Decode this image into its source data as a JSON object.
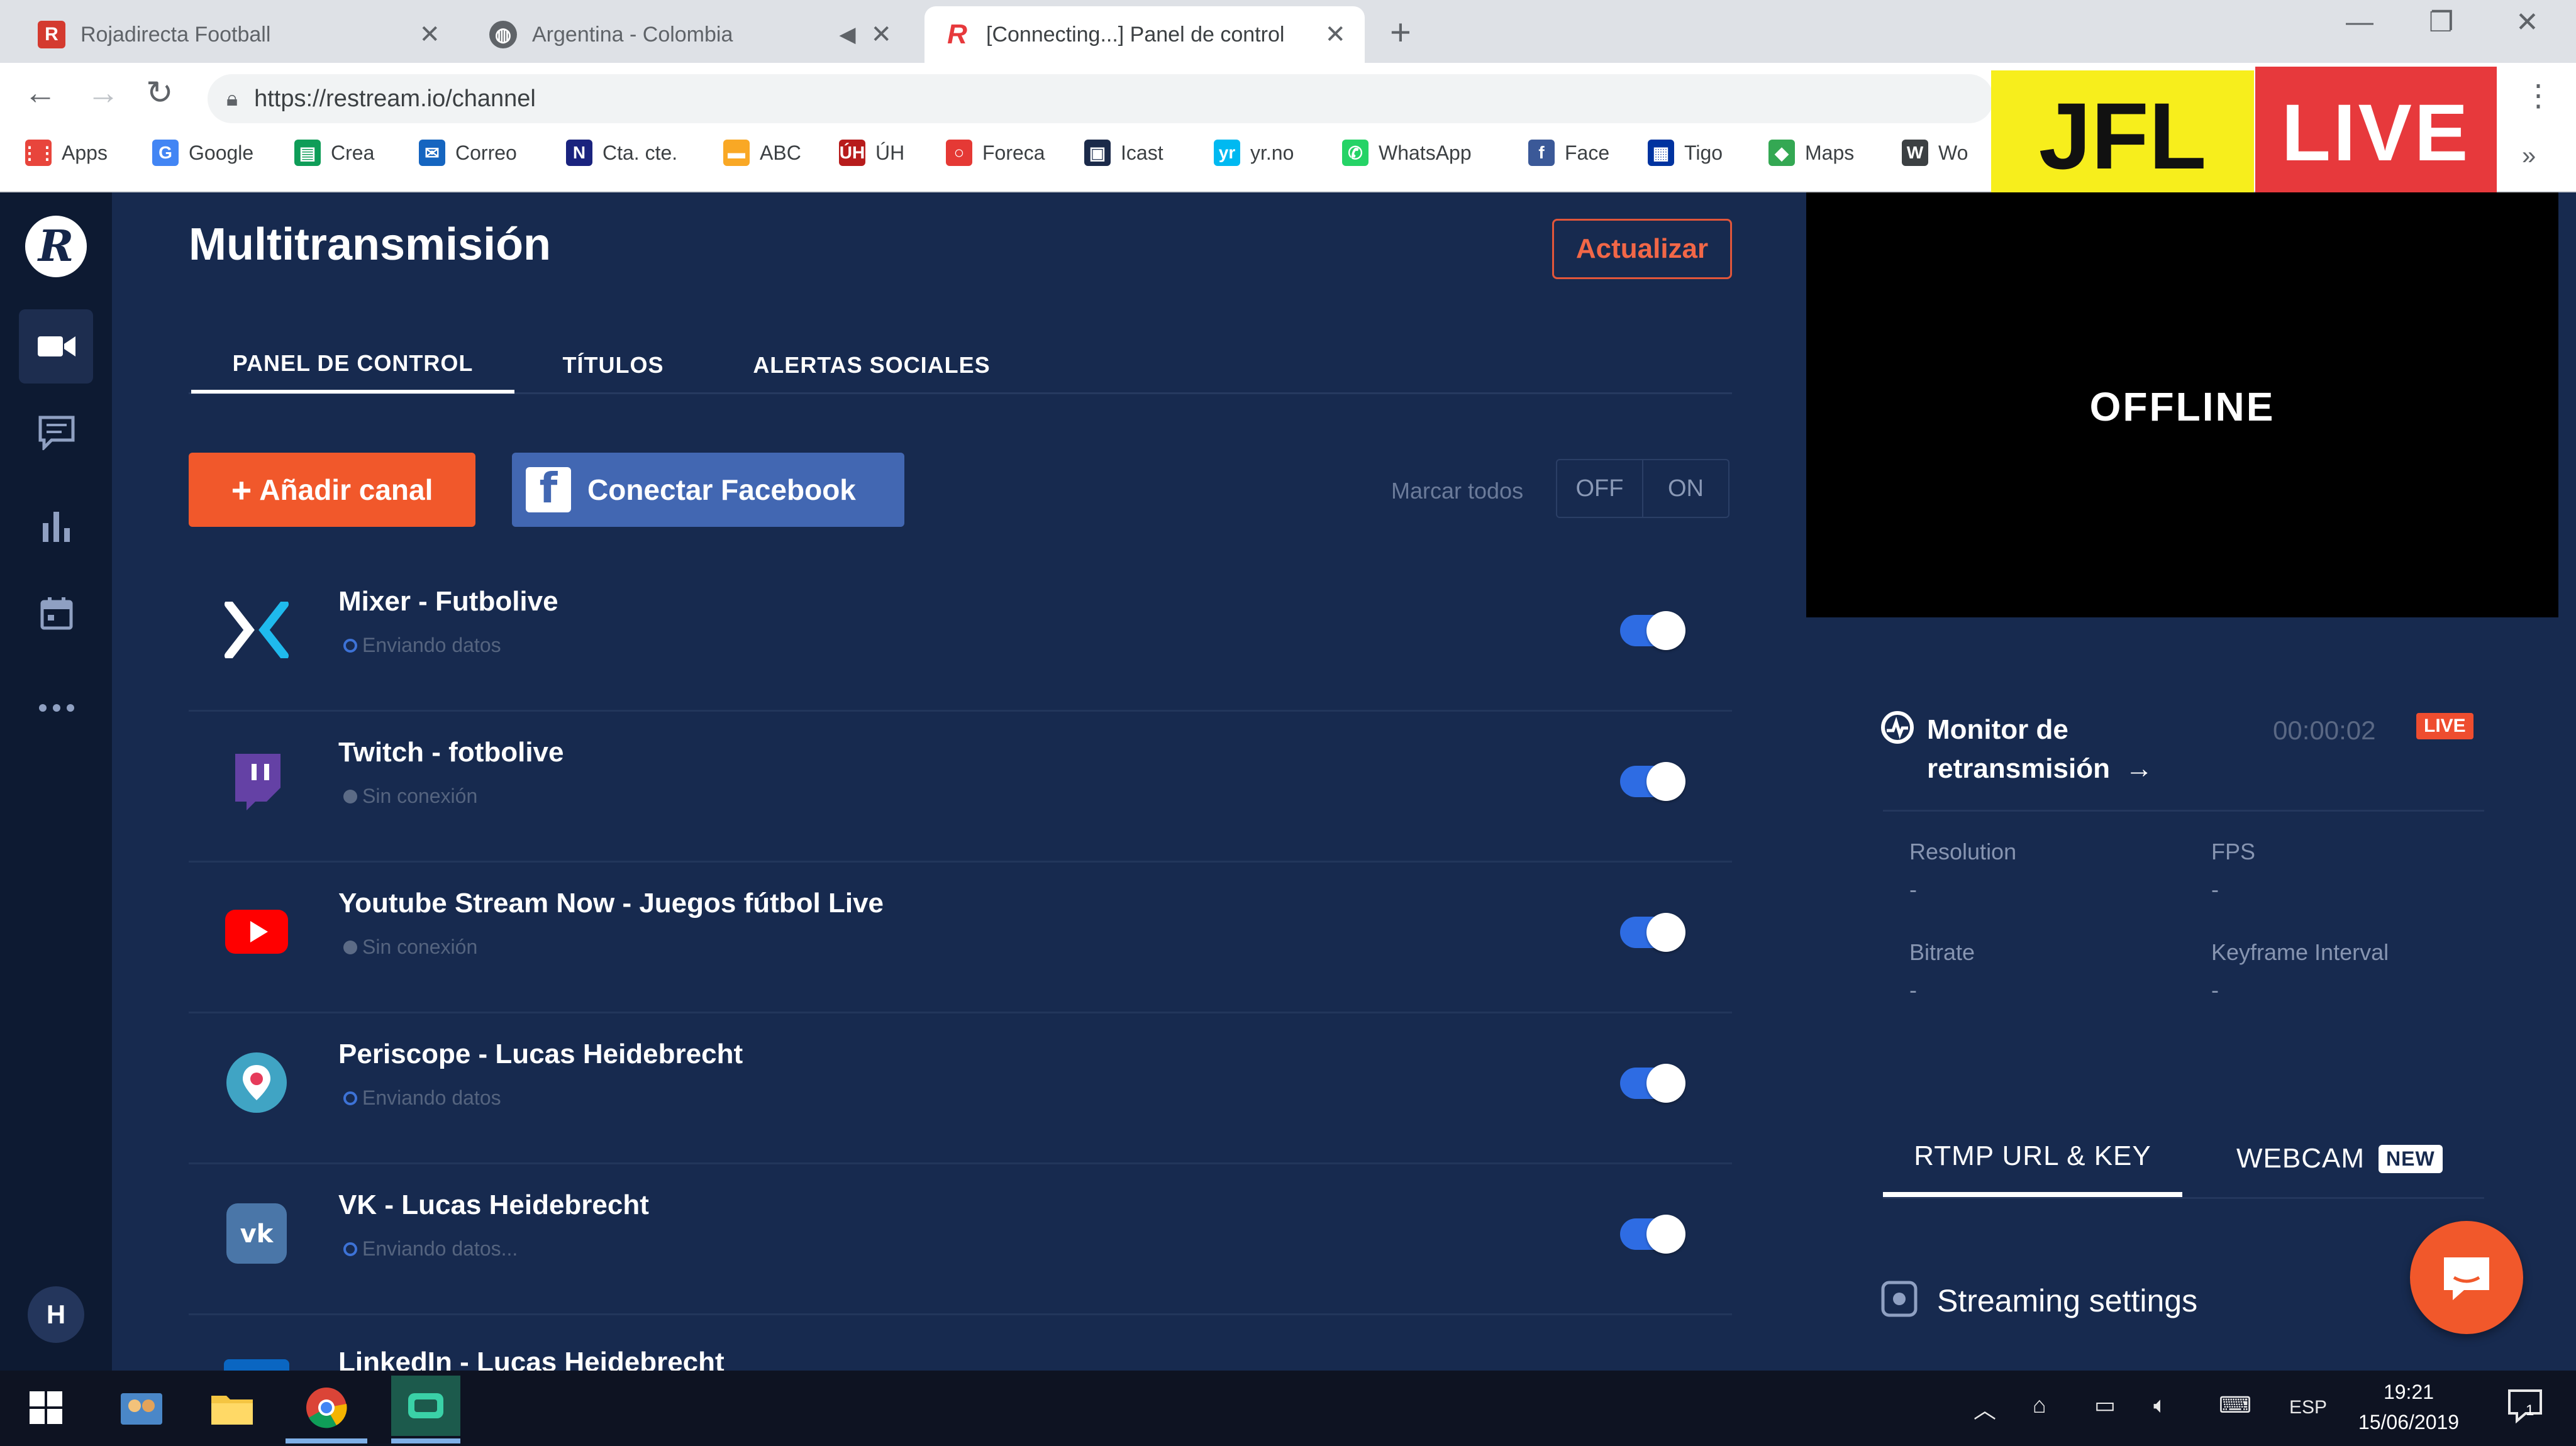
{
  "browser": {
    "tabs": [
      {
        "title": "Rojadirecta Football",
        "favicon": "rojadirecta-icon",
        "color": "#d43a2f"
      },
      {
        "title": "Argentina - Colombia",
        "favicon": "globe-icon",
        "color": "#5f6368"
      },
      {
        "title": "[Connecting...] Panel de control",
        "favicon": "restream-icon",
        "color": "#e7393c"
      }
    ],
    "url": "https://restream.io/channel",
    "bookmarks": [
      {
        "label": "Apps",
        "icon": "apps-grid-icon",
        "color": "#e8453c"
      },
      {
        "label": "Google",
        "icon": "google-icon",
        "color": "#4285f4"
      },
      {
        "label": "Crea",
        "icon": "crea-icon",
        "color": "#0f9d58"
      },
      {
        "label": "Correo",
        "icon": "correo-icon",
        "color": "#1565c0"
      },
      {
        "label": "Cta. cte.",
        "icon": "cta-cte-icon",
        "color": "#1a237e"
      },
      {
        "label": "ABC",
        "icon": "abc-icon",
        "color": "#f9a825"
      },
      {
        "label": "ÚH",
        "icon": "uh-icon",
        "color": "#b71c1c"
      },
      {
        "label": "Foreca",
        "icon": "foreca-icon",
        "color": "#e53935"
      },
      {
        "label": "Icast",
        "icon": "icast-icon",
        "color": "#1b2a4a"
      },
      {
        "label": "yr.no",
        "icon": "yrno-icon",
        "color": "#00b9f1"
      },
      {
        "label": "WhatsApp",
        "icon": "whatsapp-icon",
        "color": "#25d366"
      },
      {
        "label": "Face",
        "icon": "facebook-icon",
        "color": "#3b5998"
      },
      {
        "label": "Tigo",
        "icon": "tigo-icon",
        "color": "#0033a0"
      },
      {
        "label": "Maps",
        "icon": "maps-icon",
        "color": "#34a853"
      },
      {
        "label": "Wo",
        "icon": "wikipedia-icon",
        "color": "#3c4043"
      }
    ]
  },
  "overlay": {
    "jfl": "JFL",
    "live": "LIVE"
  },
  "app": {
    "title": "Multitransmisión",
    "refresh_label": "Actualizar",
    "tabs": [
      "PANEL DE CONTROL",
      "TÍTULOS",
      "ALERTAS SOCIALES"
    ],
    "add_channel_label": "Añadir canal",
    "connect_facebook_label": "Conectar Facebook",
    "mark_all_label": "Marcar todos",
    "off_label": "OFF",
    "on_label": "ON",
    "channels": [
      {
        "name": "Mixer - Futbolive",
        "status": "Enviando datos",
        "platform": "mixer",
        "enabled": true
      },
      {
        "name": "Twitch - fotbolive",
        "status": "Sin conexión",
        "platform": "twitch",
        "enabled": true
      },
      {
        "name": "Youtube Stream Now - Juegos fútbol Live",
        "status": "Sin conexión",
        "platform": "youtube",
        "enabled": true
      },
      {
        "name": "Periscope - Lucas Heidebrecht",
        "status": "Enviando datos",
        "platform": "periscope",
        "enabled": true
      },
      {
        "name": "VK - Lucas Heidebrecht",
        "status": "Enviando datos...",
        "platform": "vk",
        "enabled": true
      },
      {
        "name": "LinkedIn - Lucas Heidebrecht",
        "status": "",
        "platform": "linkedin",
        "enabled": true
      }
    ],
    "user_initial": "H"
  },
  "panel": {
    "preview_text": "OFFLINE",
    "monitor_title": "Monitor de retransmisión",
    "timer": "00:00:02",
    "live_chip": "LIVE",
    "stats": [
      {
        "label": "Resolution",
        "value": "-"
      },
      {
        "label": "FPS",
        "value": "-"
      },
      {
        "label": "Bitrate",
        "value": "-"
      },
      {
        "label": "Keyframe Interval",
        "value": "-"
      }
    ],
    "tabs": [
      "RTMP URL & KEY",
      "WEBCAM"
    ],
    "new_chip": "NEW",
    "streaming_settings": "Streaming settings"
  },
  "taskbar": {
    "language": "ESP",
    "time": "19:21",
    "date": "15/06/2019",
    "notification_count": "1"
  },
  "colors": {
    "accent_orange": "#f1582b",
    "facebook_blue": "#4267b2",
    "toggle_blue": "#2e6ce3",
    "bg_main": "#172a4f",
    "bg_rail": "#0d1a32"
  }
}
